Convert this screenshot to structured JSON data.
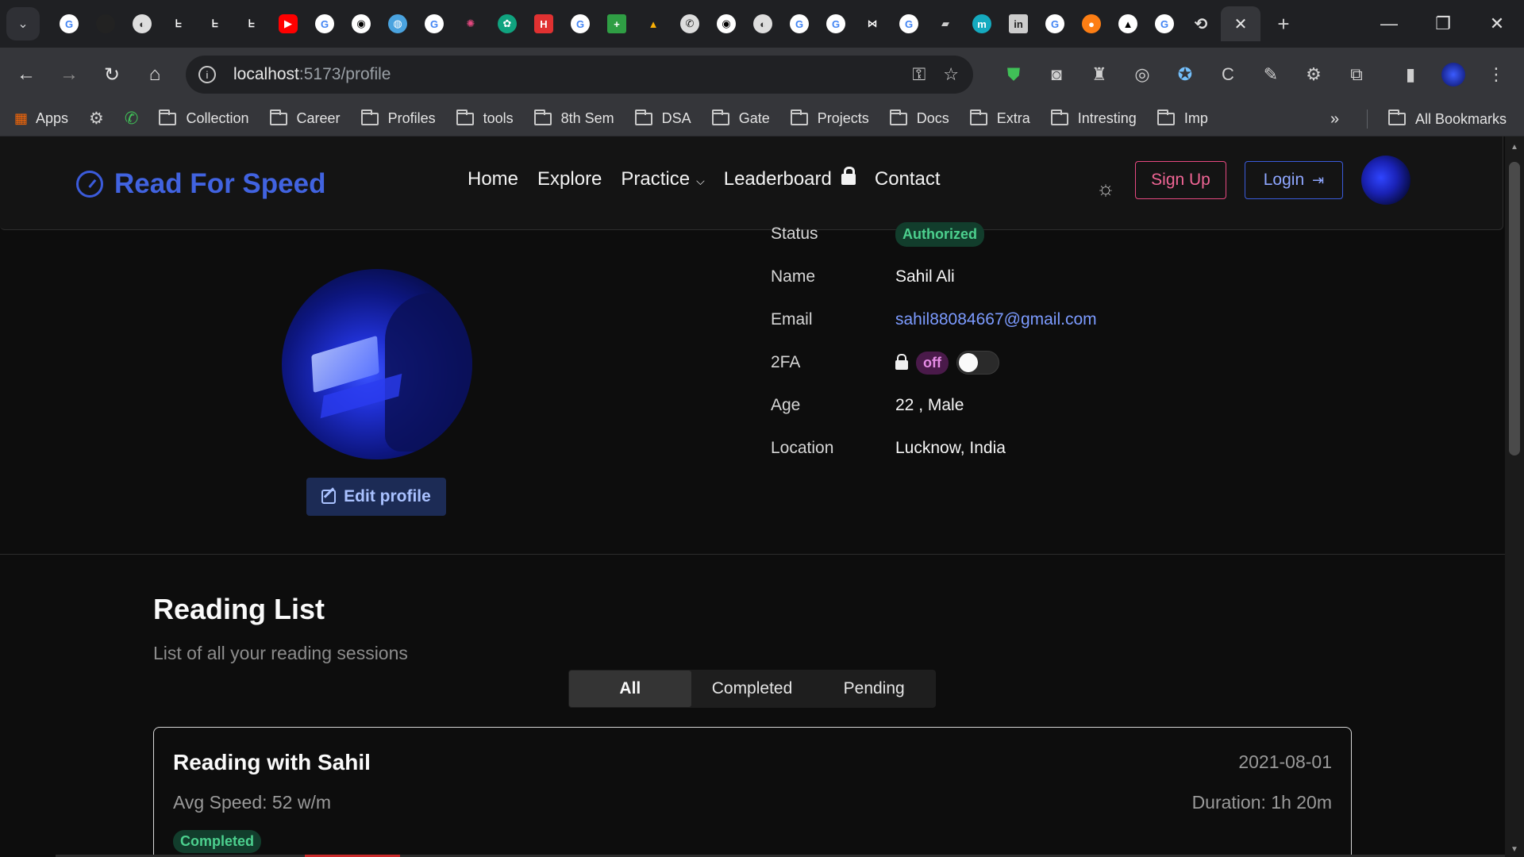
{
  "browser": {
    "address": {
      "host": "localhost",
      "path": ":5173/profile"
    },
    "bookmarks": [
      {
        "label": "Apps",
        "type": "apps"
      },
      {
        "label": "",
        "type": "gear"
      },
      {
        "label": "",
        "type": "whatsapp"
      },
      {
        "label": "Collection",
        "type": "folder"
      },
      {
        "label": "Career",
        "type": "folder"
      },
      {
        "label": "Profiles",
        "type": "folder"
      },
      {
        "label": "tools",
        "type": "folder"
      },
      {
        "label": "8th Sem",
        "type": "folder"
      },
      {
        "label": "DSA",
        "type": "folder"
      },
      {
        "label": "Gate",
        "type": "folder"
      },
      {
        "label": "Projects",
        "type": "folder"
      },
      {
        "label": "Docs",
        "type": "folder"
      },
      {
        "label": "Extra",
        "type": "folder"
      },
      {
        "label": "Intresting",
        "type": "folder"
      },
      {
        "label": "Imp",
        "type": "folder"
      }
    ],
    "all_bookmarks": "All Bookmarks",
    "more_bookmarks": "»"
  },
  "site": {
    "brand": "Read For Speed",
    "nav": [
      {
        "label": "Home"
      },
      {
        "label": "Explore"
      },
      {
        "label": "Practice",
        "dropdown": true
      },
      {
        "label": "Leaderboard",
        "locked": true
      },
      {
        "label": "Contact"
      }
    ],
    "signup_label": "Sign Up",
    "login_label": "Login"
  },
  "profile": {
    "edit_label": "Edit profile",
    "rows": [
      {
        "key": "Status",
        "value": "Authorized",
        "kind": "badge"
      },
      {
        "key": "Name",
        "value": "Sahil Ali",
        "kind": "text"
      },
      {
        "key": "Email",
        "value": "sahil88084667@gmail.com",
        "kind": "link"
      },
      {
        "key": "2FA",
        "value": "off",
        "kind": "toggle"
      },
      {
        "key": "Age",
        "value": "22 , Male",
        "kind": "text"
      },
      {
        "key": "Location",
        "value": "Lucknow, India",
        "kind": "text"
      }
    ]
  },
  "reading_list": {
    "title": "Reading List",
    "subtitle": "List of all your reading sessions",
    "tabs": [
      {
        "label": "All",
        "active": true
      },
      {
        "label": "Completed",
        "active": false
      },
      {
        "label": "Pending",
        "active": false
      }
    ],
    "sessions": [
      {
        "title": "Reading with Sahil",
        "date": "2021-08-01",
        "speed": "Avg Speed: 52 w/m",
        "duration": "Duration: 1h 20m",
        "status": "Completed"
      }
    ]
  },
  "colors": {
    "brand": "#4163e0",
    "signup": "#e64980",
    "login": "#3b5bdb",
    "success": "#4cd08e",
    "link": "#7c9bff"
  }
}
